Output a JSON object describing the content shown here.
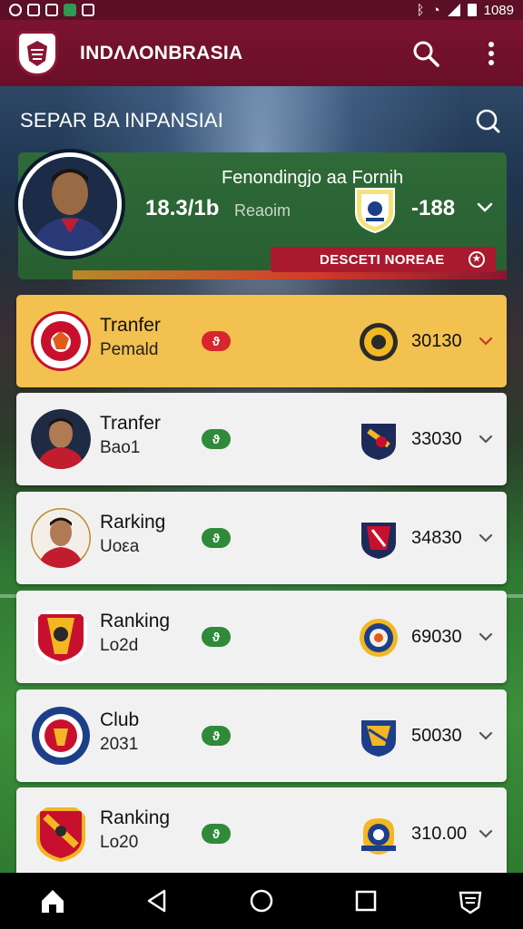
{
  "status_bar": {
    "time": "1089",
    "icons": [
      "notification-icon",
      "settings-icon",
      "chart-icon",
      "shield-icon",
      "image-icon",
      "bluetooth-icon",
      "wifi-icon",
      "signal-icon",
      "battery-icon"
    ]
  },
  "app_bar": {
    "title": "INDΛΛΟΝΒRASIA",
    "search_icon": "search-icon",
    "menu_icon": "more-vert-icon"
  },
  "section": {
    "label": "SEPAR ΒA INPANSIAI",
    "search_icon": "search-icon"
  },
  "featured": {
    "title": "Fenondingjo aa Fornih",
    "value": "18.3/1b",
    "sub": "Reaoim",
    "count": "-188",
    "badge": "DESCETI NORΕAE",
    "badge_icon": "star-circle-icon",
    "colors": {
      "bg": "#2f6a38",
      "badge": "#a91a2e"
    }
  },
  "list": [
    {
      "name": "Tranfer",
      "sub": "Pemald",
      "pill": "ϑ",
      "count": "30130",
      "active": true,
      "pill_color": "#d7262e"
    },
    {
      "name": "Tranfer",
      "sub": "Bao1",
      "pill": "ϑ",
      "count": "33030",
      "active": false,
      "pill_color": "#2f8a3a"
    },
    {
      "name": "Rarking",
      "sub": "Uoεa",
      "pill": "ϑ",
      "count": "34830",
      "active": false,
      "pill_color": "#2f8a3a"
    },
    {
      "name": "Ranking",
      "sub": "Lo2d",
      "pill": "ϑ",
      "count": "69030",
      "active": false,
      "pill_color": "#2f8a3a"
    },
    {
      "name": "Club",
      "sub": "2031",
      "pill": "ϑ",
      "count": "50030",
      "active": false,
      "pill_color": "#2f8a3a"
    },
    {
      "name": "Ranking",
      "sub": "Lo20",
      "pill": "ϑ",
      "count": "310.00",
      "active": false,
      "pill_color": "#2f8a3a"
    }
  ],
  "nav": [
    "home-icon",
    "back-icon",
    "home-circle-icon",
    "recents-icon",
    "badge-icon"
  ],
  "colors": {
    "primary": "#6a0f28",
    "status_bar": "#5c0f26",
    "accent": "#f2c14f",
    "card": "#f1f1f1"
  }
}
